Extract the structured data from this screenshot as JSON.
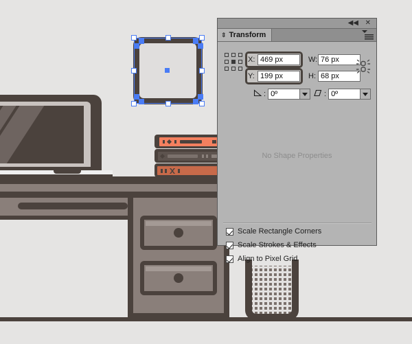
{
  "canvas": {
    "background_color": "#e5e4e3",
    "artwork_name": "desk-illustration",
    "objects": {
      "laptop": "laptop",
      "books": "book-stack",
      "desk": "desk",
      "drawers": "drawer-cabinet",
      "wastebasket": "mesh-wastebasket",
      "selected_shape": "rounded-rectangle"
    }
  },
  "selection": {
    "accent_color": "#4a7cf5",
    "handle_fill": "#ffffff"
  },
  "panel": {
    "title": "Transform",
    "tab_icon": "updown-arrow-icon",
    "collapse_label": "◀◀",
    "close_label": "✕",
    "menu_label": "panel-menu-icon",
    "reference_point": "center",
    "fields": {
      "x_label": "X:",
      "x_value": "469 px",
      "y_label": "Y:",
      "y_value": "199 px",
      "w_label": "W:",
      "w_value": "76 px",
      "h_label": "H:",
      "h_value": "68 px",
      "angle_label": "rotate-icon",
      "angle_value": "0º",
      "shear_label": "shear-icon",
      "shear_value": "0º",
      "constrain_icon": "broken-link-icon"
    },
    "placeholder_text": "No Shape Properties",
    "checkboxes": [
      {
        "label": "Scale Rectangle Corners",
        "checked": true
      },
      {
        "label": "Scale Strokes & Effects",
        "checked": true
      },
      {
        "label": "Align to Pixel Grid",
        "checked": true
      }
    ]
  },
  "colors": {
    "panel_bg": "#b4b4b4",
    "panel_titlebar": "#9a9a9a",
    "art_dark": "#4b423d",
    "art_gray": "#8a7f7a",
    "book_top": "#f4805f",
    "book_bottom": "#c86a4a"
  }
}
